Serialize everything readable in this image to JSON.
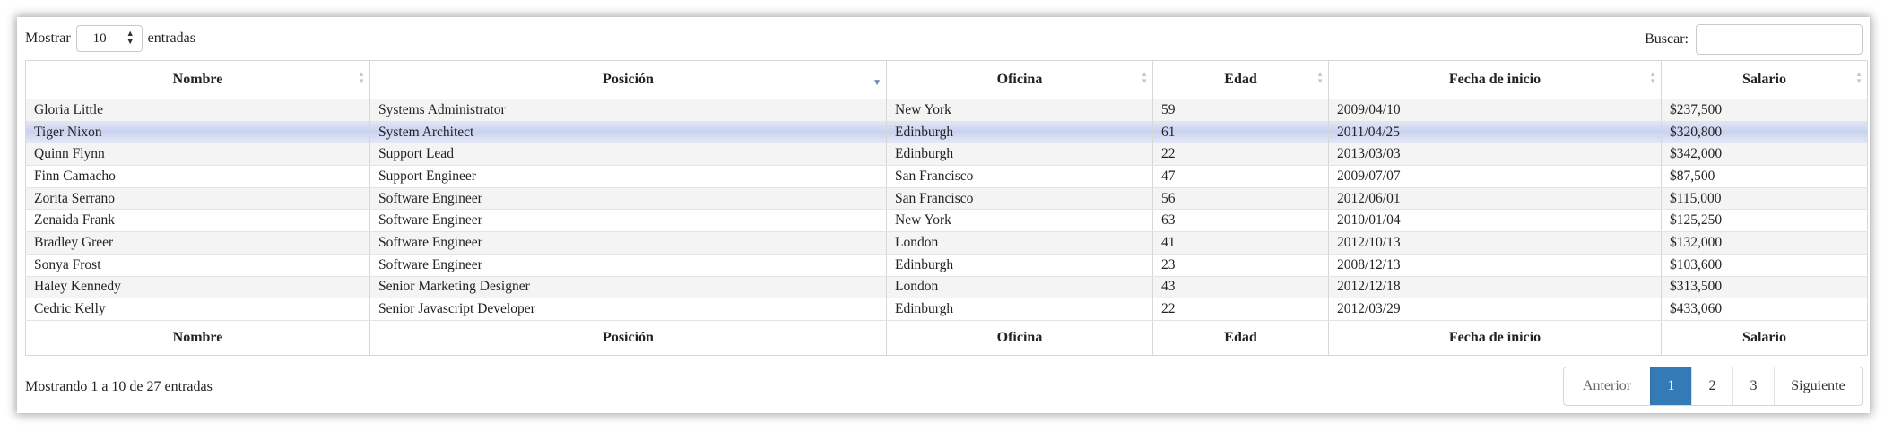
{
  "length_menu": {
    "prefix": "Mostrar",
    "value": "10",
    "suffix": "entradas"
  },
  "search": {
    "label": "Buscar:",
    "value": ""
  },
  "columns": [
    "Nombre",
    "Posición",
    "Oficina",
    "Edad",
    "Fecha de inicio",
    "Salario"
  ],
  "rows": [
    [
      "Gloria Little",
      "Systems Administrator",
      "New York",
      "59",
      "2009/04/10",
      "$237,500"
    ],
    [
      "Tiger Nixon",
      "System Architect",
      "Edinburgh",
      "61",
      "2011/04/25",
      "$320,800"
    ],
    [
      "Quinn Flynn",
      "Support Lead",
      "Edinburgh",
      "22",
      "2013/03/03",
      "$342,000"
    ],
    [
      "Finn Camacho",
      "Support Engineer",
      "San Francisco",
      "47",
      "2009/07/07",
      "$87,500"
    ],
    [
      "Zorita Serrano",
      "Software Engineer",
      "San Francisco",
      "56",
      "2012/06/01",
      "$115,000"
    ],
    [
      "Zenaida Frank",
      "Software Engineer",
      "New York",
      "63",
      "2010/01/04",
      "$125,250"
    ],
    [
      "Bradley Greer",
      "Software Engineer",
      "London",
      "41",
      "2012/10/13",
      "$132,000"
    ],
    [
      "Sonya Frost",
      "Software Engineer",
      "Edinburgh",
      "23",
      "2008/12/13",
      "$103,600"
    ],
    [
      "Haley Kennedy",
      "Senior Marketing Designer",
      "London",
      "43",
      "2012/12/18",
      "$313,500"
    ],
    [
      "Cedric Kelly",
      "Senior Javascript Developer",
      "Edinburgh",
      "22",
      "2012/03/29",
      "$433,060"
    ]
  ],
  "highlighted_row": 1,
  "sorted_column": 1,
  "sort_direction": "descending",
  "info": "Mostrando 1 a 10 de 27 entradas",
  "pagination": {
    "previous": "Anterior",
    "pages": [
      "1",
      "2",
      "3"
    ],
    "current": "1",
    "next": "Siguiente"
  },
  "colors": {
    "accent": "#337ab7",
    "row_highlight": "#c9d2ef",
    "sort_indicator": "#6b7fb0"
  }
}
